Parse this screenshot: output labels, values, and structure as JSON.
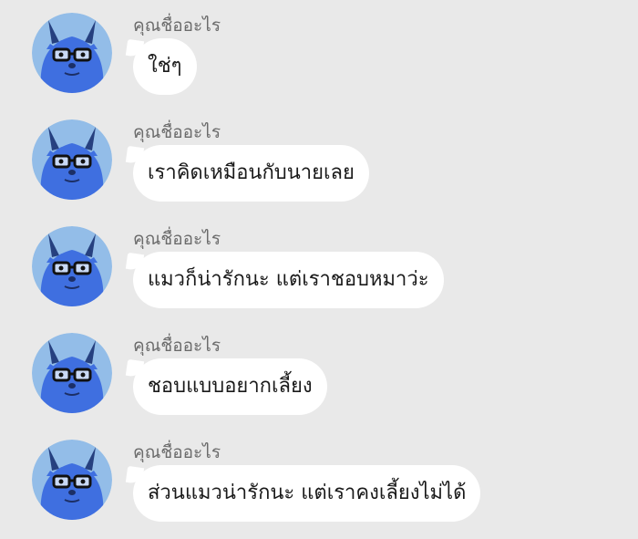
{
  "messages": [
    {
      "sender": "คุณชื่ออะไร",
      "text": "ใช่ๆ"
    },
    {
      "sender": "คุณชื่ออะไร",
      "text": "เราคิดเหมือนกับนายเลย"
    },
    {
      "sender": "คุณชื่ออะไร",
      "text": "แมวก็น่ารักนะ แต่เราชอบหมาว่ะ"
    },
    {
      "sender": "คุณชื่ออะไร",
      "text": "ชอบแบบอยากเลี้ยง"
    },
    {
      "sender": "คุณชื่ออะไร",
      "text": "ส่วนแมวน่ารักนะ แต่เราคงเลี้ยงไม่ได้"
    }
  ],
  "avatar": {
    "icon": "blue-monster-with-glasses-icon",
    "bg_color": "#93bde8",
    "body_color": "#3f6fe0",
    "horn_color": "#26407f"
  }
}
